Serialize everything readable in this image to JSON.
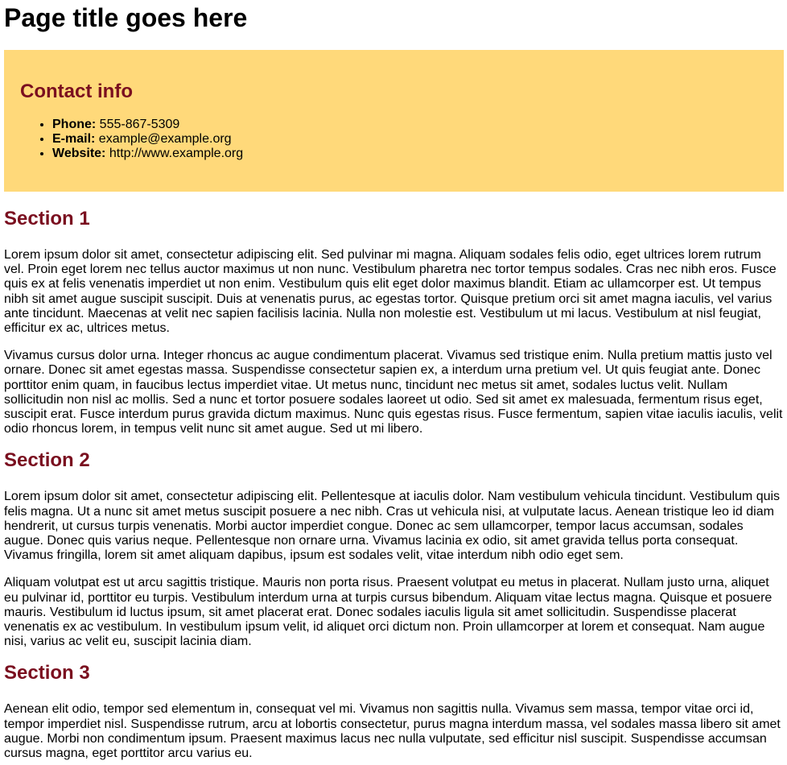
{
  "page": {
    "title": "Page title goes here"
  },
  "contact": {
    "heading": "Contact info",
    "items": [
      {
        "label": "Phone:",
        "value": "555-867-5309"
      },
      {
        "label": "E-mail:",
        "value": "example@example.org"
      },
      {
        "label": "Website:",
        "value": "http://www.example.org"
      }
    ],
    "background_color": "#ffd97a",
    "heading_color": "#7a0f1f"
  },
  "sections": [
    {
      "heading": "Section 1",
      "paragraphs": [
        "Lorem ipsum dolor sit amet, consectetur adipiscing elit. Sed pulvinar mi magna. Aliquam sodales felis odio, eget ultrices lorem rutrum vel. Proin eget lorem nec tellus auctor maximus ut non nunc. Vestibulum pharetra nec tortor tempus sodales. Cras nec nibh eros. Fusce quis ex at felis venenatis imperdiet ut non enim. Vestibulum quis elit eget dolor maximus blandit. Etiam ac ullamcorper est. Ut tempus nibh sit amet augue suscipit suscipit. Duis at venenatis purus, ac egestas tortor. Quisque pretium orci sit amet magna iaculis, vel varius ante tincidunt. Maecenas at velit nec sapien facilisis lacinia. Nulla non molestie est. Vestibulum ut mi lacus. Vestibulum at nisl feugiat, efficitur ex ac, ultrices metus.",
        "Vivamus cursus dolor urna. Integer rhoncus ac augue condimentum placerat. Vivamus sed tristique enim. Nulla pretium mattis justo vel ornare. Donec sit amet egestas massa. Suspendisse consectetur sapien ex, a interdum urna pretium vel. Ut quis feugiat ante. Donec porttitor enim quam, in faucibus lectus imperdiet vitae. Ut metus nunc, tincidunt nec metus sit amet, sodales luctus velit. Nullam sollicitudin non nisl ac mollis. Sed a nunc et tortor posuere sodales laoreet ut odio. Sed sit amet ex malesuada, fermentum risus eget, suscipit erat. Fusce interdum purus gravida dictum maximus. Nunc quis egestas risus. Fusce fermentum, sapien vitae iaculis iaculis, velit odio rhoncus lorem, in tempus velit nunc sit amet augue. Sed ut mi libero."
      ]
    },
    {
      "heading": "Section 2",
      "paragraphs": [
        "Lorem ipsum dolor sit amet, consectetur adipiscing elit. Pellentesque at iaculis dolor. Nam vestibulum vehicula tincidunt. Vestibulum quis felis magna. Ut a nunc sit amet metus suscipit posuere a nec nibh. Cras ut vehicula nisi, at vulputate lacus. Aenean tristique leo id diam hendrerit, ut cursus turpis venenatis. Morbi auctor imperdiet congue. Donec ac sem ullamcorper, tempor lacus accumsan, sodales augue. Donec quis varius neque. Pellentesque non ornare urna. Vivamus lacinia ex odio, sit amet gravida tellus porta consequat. Vivamus fringilla, lorem sit amet aliquam dapibus, ipsum est sodales velit, vitae interdum nibh odio eget sem.",
        "Aliquam volutpat est ut arcu sagittis tristique. Mauris non porta risus. Praesent volutpat eu metus in placerat. Nullam justo urna, aliquet eu pulvinar id, porttitor eu turpis. Vestibulum interdum urna at turpis cursus bibendum. Aliquam vitae lectus magna. Quisque et posuere mauris. Vestibulum id luctus ipsum, sit amet placerat erat. Donec sodales iaculis ligula sit amet sollicitudin. Suspendisse placerat venenatis ex ac vestibulum. In vestibulum ipsum velit, id aliquet orci dictum non. Proin ullamcorper at lorem et consequat. Nam augue nisi, varius ac velit eu, suscipit lacinia diam."
      ]
    },
    {
      "heading": "Section 3",
      "paragraphs": [
        "Aenean elit odio, tempor sed elementum in, consequat vel mi. Vivamus non sagittis nulla. Vivamus sem massa, tempor vitae orci id, tempor imperdiet nisl. Suspendisse rutrum, arcu at lobortis consectetur, purus magna interdum massa, vel sodales massa libero sit amet augue. Morbi non condimentum ipsum. Praesent maximus lacus nec nulla vulputate, sed efficitur nisl suscipit. Suspendisse accumsan cursus magna, eget porttitor arcu varius eu."
      ]
    }
  ]
}
